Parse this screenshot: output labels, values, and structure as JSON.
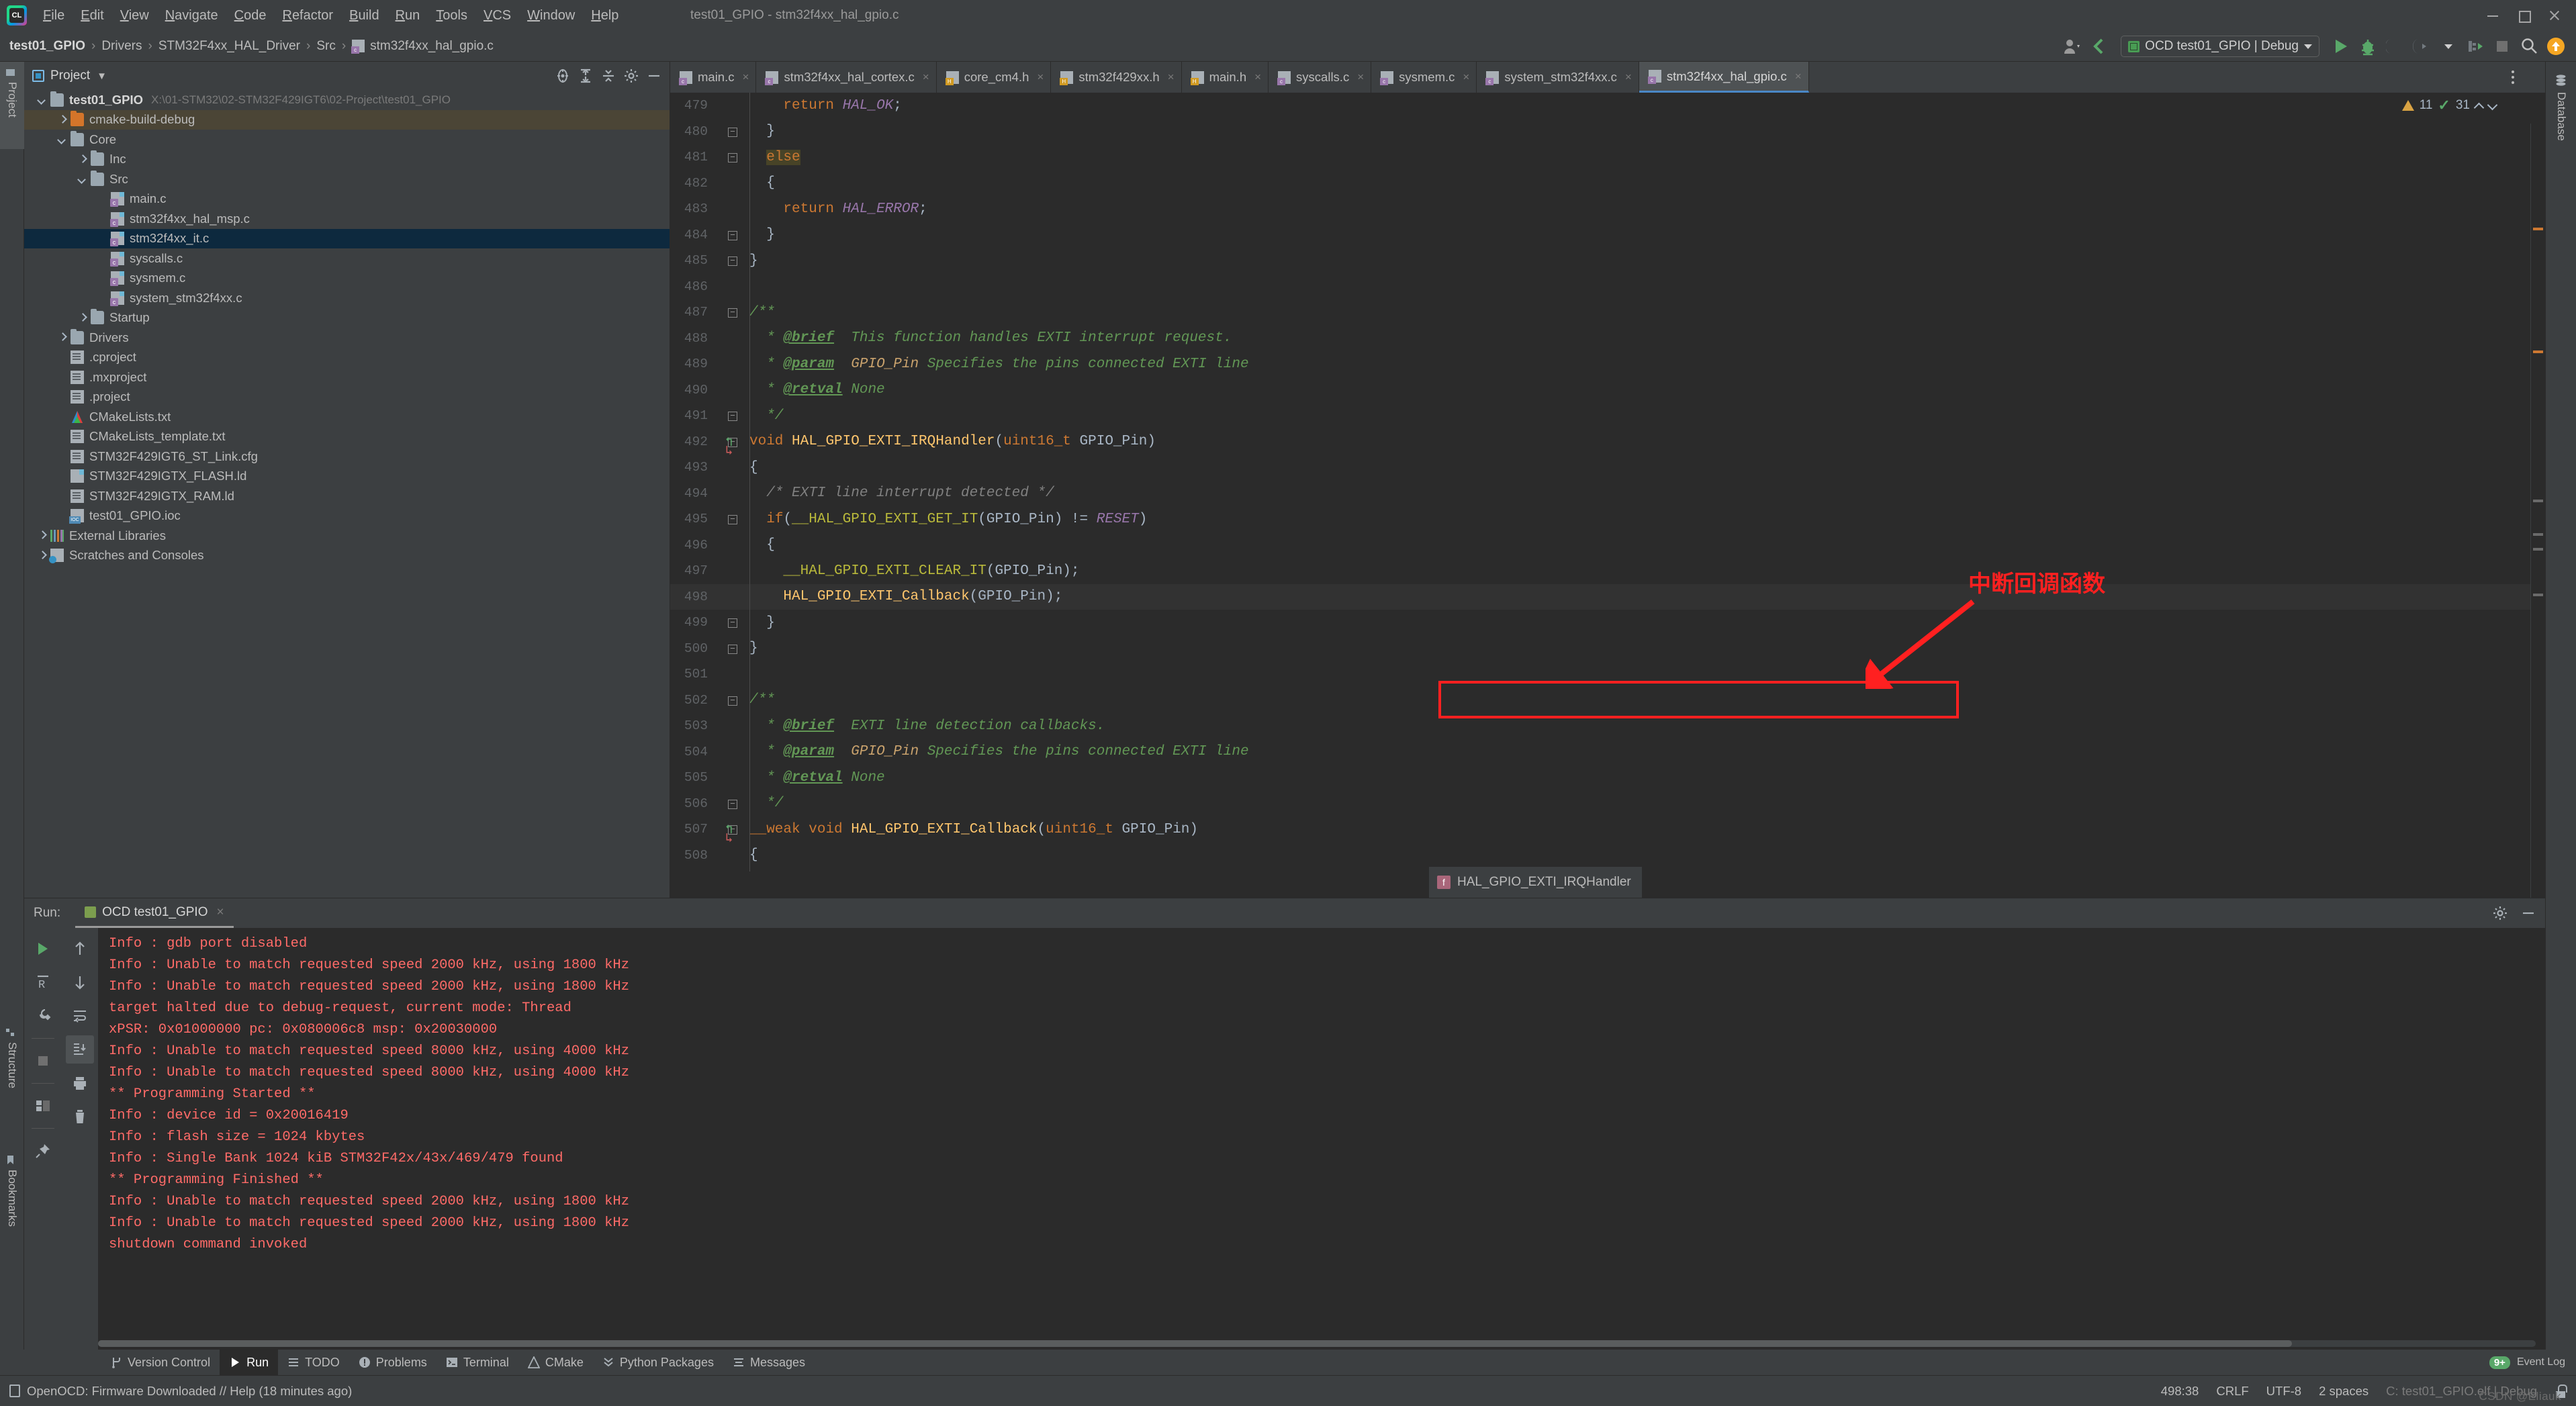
{
  "window": {
    "title": "test01_GPIO - stm32f4xx_hal_gpio.c",
    "menu": [
      "File",
      "Edit",
      "View",
      "Navigate",
      "Code",
      "Refactor",
      "Build",
      "Run",
      "Tools",
      "VCS",
      "Window",
      "Help"
    ]
  },
  "breadcrumb": {
    "items": [
      "test01_GPIO",
      "Drivers",
      "STM32F4xx_HAL_Driver",
      "Src",
      "stm32f4xx_hal_gpio.c"
    ],
    "separator": "›"
  },
  "toolbar": {
    "run_config": "OCD test01_GPIO | Debug",
    "caret": "▼"
  },
  "project_panel": {
    "title": "Project",
    "caret": "▼",
    "root": "test01_GPIO",
    "root_path": "X:\\01-STM32\\02-STM32F429IGT6\\02-Project\\test01_GPIO",
    "tree": [
      {
        "label": "cmake-build-debug",
        "indent": 1,
        "icon": "folder-orange",
        "arrow": "right",
        "state": "build"
      },
      {
        "label": "Core",
        "indent": 1,
        "icon": "folder",
        "arrow": "down",
        "state": ""
      },
      {
        "label": "Inc",
        "indent": 2,
        "icon": "folder",
        "arrow": "right",
        "state": ""
      },
      {
        "label": "Src",
        "indent": 2,
        "icon": "folder",
        "arrow": "down",
        "state": ""
      },
      {
        "label": "main.c",
        "indent": 3,
        "icon": "c-file",
        "arrow": "none",
        "state": ""
      },
      {
        "label": "stm32f4xx_hal_msp.c",
        "indent": 3,
        "icon": "c-file",
        "arrow": "none",
        "state": ""
      },
      {
        "label": "stm32f4xx_it.c",
        "indent": 3,
        "icon": "c-file",
        "arrow": "none",
        "state": "selected"
      },
      {
        "label": "syscalls.c",
        "indent": 3,
        "icon": "c-file",
        "arrow": "none",
        "state": ""
      },
      {
        "label": "sysmem.c",
        "indent": 3,
        "icon": "c-file",
        "arrow": "none",
        "state": ""
      },
      {
        "label": "system_stm32f4xx.c",
        "indent": 3,
        "icon": "c-file",
        "arrow": "none",
        "state": ""
      },
      {
        "label": "Startup",
        "indent": 2,
        "icon": "folder",
        "arrow": "right",
        "state": ""
      },
      {
        "label": "Drivers",
        "indent": 1,
        "icon": "folder",
        "arrow": "right",
        "state": ""
      },
      {
        "label": ".cproject",
        "indent": 1,
        "icon": "txt-file",
        "arrow": "none",
        "state": ""
      },
      {
        "label": ".mxproject",
        "indent": 1,
        "icon": "txt-file",
        "arrow": "none",
        "state": ""
      },
      {
        "label": ".project",
        "indent": 1,
        "icon": "txt-file",
        "arrow": "none",
        "state": ""
      },
      {
        "label": "CMakeLists.txt",
        "indent": 1,
        "icon": "cmake",
        "arrow": "none",
        "state": ""
      },
      {
        "label": "CMakeLists_template.txt",
        "indent": 1,
        "icon": "txt-file",
        "arrow": "none",
        "state": ""
      },
      {
        "label": "STM32F429IGT6_ST_Link.cfg",
        "indent": 1,
        "icon": "txt-file",
        "arrow": "none",
        "state": ""
      },
      {
        "label": "STM32F429IGTX_FLASH.ld",
        "indent": 1,
        "icon": "ld-file",
        "arrow": "none",
        "state": ""
      },
      {
        "label": "STM32F429IGTX_RAM.ld",
        "indent": 1,
        "icon": "txt-file",
        "arrow": "none",
        "state": ""
      },
      {
        "label": "test01_GPIO.ioc",
        "indent": 1,
        "icon": "ioc-file",
        "arrow": "none",
        "state": ""
      },
      {
        "label": "External Libraries",
        "indent": 0,
        "icon": "lib",
        "arrow": "right",
        "state": ""
      },
      {
        "label": "Scratches and Consoles",
        "indent": 0,
        "icon": "scratch",
        "arrow": "right",
        "state": ""
      }
    ]
  },
  "left_tool_tabs": [
    {
      "label": "Project",
      "icon": "project-icon",
      "active": true
    },
    {
      "label": "Structure",
      "icon": "structure-icon",
      "active": false
    },
    {
      "label": "Bookmarks",
      "icon": "bookmark-icon",
      "active": false
    }
  ],
  "right_tool_tabs": [
    {
      "label": "Database",
      "icon": "database-icon",
      "active": false
    }
  ],
  "editor": {
    "tabs": [
      {
        "label": "main.c",
        "type": "c",
        "active": false
      },
      {
        "label": "stm32f4xx_hal_cortex.c",
        "type": "c",
        "active": false
      },
      {
        "label": "core_cm4.h",
        "type": "h",
        "active": false
      },
      {
        "label": "stm32f429xx.h",
        "type": "h",
        "active": false
      },
      {
        "label": "main.h",
        "type": "h",
        "active": false
      },
      {
        "label": "syscalls.c",
        "type": "c",
        "active": false
      },
      {
        "label": "sysmem.c",
        "type": "c",
        "active": false
      },
      {
        "label": "system_stm32f4xx.c",
        "type": "c",
        "active": false
      },
      {
        "label": "stm32f4xx_hal_gpio.c",
        "type": "c",
        "active": true
      }
    ],
    "close_glyph": "×",
    "inspection": {
      "warnings": "11",
      "checks": "31"
    },
    "breakpoint_hint": "HAL_GPIO_EXTI_IRQHandler",
    "annotation_cn": "中断回调函数",
    "lines": [
      {
        "n": "479",
        "fold": "",
        "text": "    return HAL_OK;"
      },
      {
        "n": "480",
        "fold": "minus",
        "text": "  }"
      },
      {
        "n": "481",
        "fold": "minus",
        "text": "  else",
        "highlight": "else"
      },
      {
        "n": "482",
        "fold": "",
        "text": "  {"
      },
      {
        "n": "483",
        "fold": "",
        "text": "    return HAL_ERROR;"
      },
      {
        "n": "484",
        "fold": "minus",
        "text": "  }"
      },
      {
        "n": "485",
        "fold": "minus",
        "text": "}"
      },
      {
        "n": "486",
        "fold": "",
        "text": ""
      },
      {
        "n": "487",
        "fold": "minus",
        "text": "/**"
      },
      {
        "n": "488",
        "fold": "",
        "text": "  * @brief  This function handles EXTI interrupt request."
      },
      {
        "n": "489",
        "fold": "",
        "text": "  * @param  GPIO_Pin Specifies the pins connected EXTI line"
      },
      {
        "n": "490",
        "fold": "",
        "text": "  * @retval None"
      },
      {
        "n": "491",
        "fold": "minus",
        "text": "  */"
      },
      {
        "n": "492",
        "fold": "minus",
        "text": "void HAL_GPIO_EXTI_IRQHandler(uint16_t GPIO_Pin)",
        "override": true
      },
      {
        "n": "493",
        "fold": "",
        "text": "{"
      },
      {
        "n": "494",
        "fold": "",
        "text": "  /* EXTI line interrupt detected */"
      },
      {
        "n": "495",
        "fold": "minus",
        "text": "  if(__HAL_GPIO_EXTI_GET_IT(GPIO_Pin) != RESET)"
      },
      {
        "n": "496",
        "fold": "",
        "text": "  {"
      },
      {
        "n": "497",
        "fold": "",
        "text": "    __HAL_GPIO_EXTI_CLEAR_IT(GPIO_Pin);"
      },
      {
        "n": "498",
        "fold": "",
        "text": "    HAL_GPIO_EXTI_Callback(GPIO_Pin);",
        "current": true
      },
      {
        "n": "499",
        "fold": "minus",
        "text": "  }"
      },
      {
        "n": "500",
        "fold": "minus",
        "text": "}"
      },
      {
        "n": "501",
        "fold": "",
        "text": ""
      },
      {
        "n": "502",
        "fold": "minus",
        "text": "/**"
      },
      {
        "n": "503",
        "fold": "",
        "text": "  * @brief  EXTI line detection callbacks."
      },
      {
        "n": "504",
        "fold": "",
        "text": "  * @param  GPIO_Pin Specifies the pins connected EXTI line"
      },
      {
        "n": "505",
        "fold": "",
        "text": "  * @retval None"
      },
      {
        "n": "506",
        "fold": "minus",
        "text": "  */"
      },
      {
        "n": "507",
        "fold": "minus",
        "text": "__weak void HAL_GPIO_EXTI_Callback(uint16_t GPIO_Pin)",
        "override": true
      },
      {
        "n": "508",
        "fold": "",
        "text": "{"
      }
    ]
  },
  "run_panel": {
    "label": "Run:",
    "tab": "OCD test01_GPIO",
    "close_glyph": "×",
    "console": [
      "Info : gdb port disabled",
      "Info : Unable to match requested speed 2000 kHz, using 1800 kHz",
      "Info : Unable to match requested speed 2000 kHz, using 1800 kHz",
      "target halted due to debug-request, current mode: Thread",
      "xPSR: 0x01000000 pc: 0x080006c8 msp: 0x20030000",
      "Info : Unable to match requested speed 8000 kHz, using 4000 kHz",
      "Info : Unable to match requested speed 8000 kHz, using 4000 kHz",
      "** Programming Started **",
      "Info : device id = 0x20016419",
      "Info : flash size = 1024 kbytes",
      "Info : Single Bank 1024 kiB STM32F42x/43x/469/479 found",
      "** Programming Finished **",
      "Info : Unable to match requested speed 2000 kHz, using 1800 kHz",
      "Info : Unable to match requested speed 2000 kHz, using 1800 kHz",
      "shutdown command invoked"
    ]
  },
  "toolwindow_bar": {
    "items": [
      {
        "label": "Version Control",
        "icon": "branch-icon",
        "active": false
      },
      {
        "label": "Run",
        "icon": "play-icon",
        "active": true
      },
      {
        "label": "TODO",
        "icon": "list-icon",
        "active": false
      },
      {
        "label": "Problems",
        "icon": "warning-icon",
        "active": false
      },
      {
        "label": "Terminal",
        "icon": "terminal-icon",
        "active": false
      },
      {
        "label": "CMake",
        "icon": "cmake-icon",
        "active": false
      },
      {
        "label": "Python Packages",
        "icon": "package-icon",
        "active": false
      },
      {
        "label": "Messages",
        "icon": "messages-icon",
        "active": false
      }
    ],
    "event_log": "Event Log",
    "event_badge": "9+"
  },
  "statusbar": {
    "message": "OpenOCD: Firmware Downloaded // Help (18 minutes ago)",
    "caret_position": "498:38",
    "line_separator": "CRLF",
    "encoding": "UTF-8",
    "indent": "2 spaces",
    "build_config": "C: test01_GPIO.elf | Debug",
    "watermark": "CSDN @Eliauk"
  },
  "colors": {
    "bg": "#3c3f41",
    "editor_bg": "#2b2b2b",
    "accent_blue": "#4a88c7",
    "selection": "#0d293e",
    "red": "#ff2020",
    "console_red": "#ff6b68",
    "green": "#59a869",
    "warn": "#d9a343"
  }
}
